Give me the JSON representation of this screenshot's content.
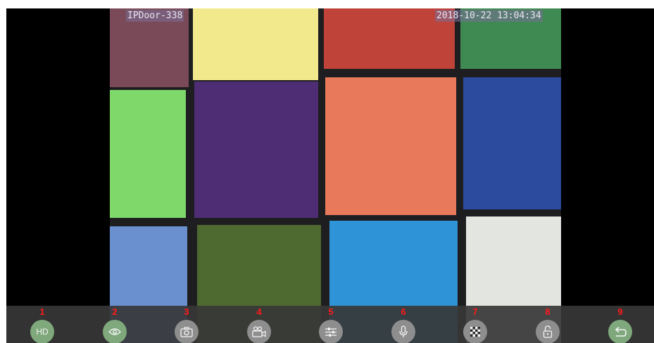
{
  "video": {
    "camera_name": "IPDoor-338",
    "timestamp": "2018-10-22 13:04:34"
  },
  "toolbar": {
    "buttons": [
      {
        "number": "1",
        "label": "HD",
        "icon": "hd-icon"
      },
      {
        "number": "2",
        "label": "",
        "icon": "eye-icon"
      },
      {
        "number": "3",
        "label": "",
        "icon": "camera-icon"
      },
      {
        "number": "4",
        "label": "",
        "icon": "video-record-icon"
      },
      {
        "number": "5",
        "label": "",
        "icon": "sliders-icon"
      },
      {
        "number": "6",
        "label": "",
        "icon": "microphone-icon"
      },
      {
        "number": "7",
        "label": "",
        "icon": "mosaic-icon"
      },
      {
        "number": "8",
        "label": "",
        "icon": "unlock-icon"
      },
      {
        "number": "9",
        "label": "",
        "icon": "back-icon"
      }
    ],
    "colors": {
      "active": "#7fa97c",
      "inactive": "#8e8e8e",
      "number": "#ff1a1a"
    }
  }
}
